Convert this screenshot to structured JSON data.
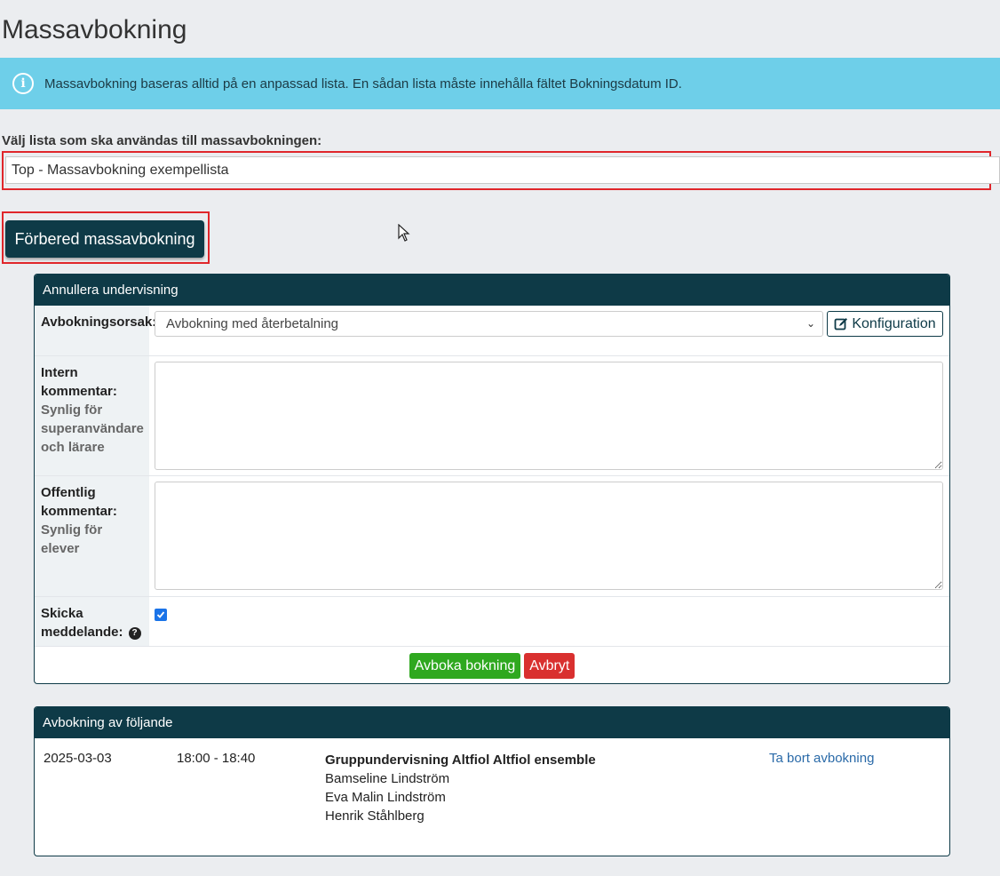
{
  "page": {
    "title": "Massavbokning"
  },
  "info": {
    "message": "Massavbokning baseras alltid på en anpassad lista. En sådan lista måste innehålla fältet Bokningsdatum ID.",
    "icon": "info-icon"
  },
  "list_select": {
    "label": "Välj lista som ska användas till massavbokningen:",
    "value": "Top - Massavbokning exempellista"
  },
  "prepare_button": {
    "label": "Förbered massavbokning"
  },
  "cancel_panel": {
    "title": "Annullera undervisning",
    "reason": {
      "label": "Avbokningsorsak:",
      "value": "Avbokning med återbetalning",
      "config_label": "Konfiguration"
    },
    "internal_comment": {
      "label": "Intern kommentar:",
      "hint": "Synlig för superanvändare och lärare",
      "value": ""
    },
    "public_comment": {
      "label": "Offentlig kommentar:",
      "hint": "Synlig för elever",
      "value": ""
    },
    "notify": {
      "label": "Skicka meddelande:",
      "checked": true
    },
    "submit_label": "Avboka bokning",
    "abort_label": "Avbryt"
  },
  "bookings_panel": {
    "title": "Avbokning av följande",
    "rows": [
      {
        "date": "2025-03-03",
        "time": "18:00 - 18:40",
        "course": "Gruppundervisning Altfiol Altfiol ensemble",
        "students": [
          "Bamseline Lindström",
          "Eva Malin Lindström",
          "Henrik Ståhlberg"
        ],
        "remove_label": "Ta bort avbokning"
      }
    ]
  },
  "colors": {
    "accent": "#0e3a47",
    "info_bg": "#6ecfe9",
    "highlight": "#e0262b",
    "success": "#2fa81f",
    "danger": "#d9302f"
  }
}
